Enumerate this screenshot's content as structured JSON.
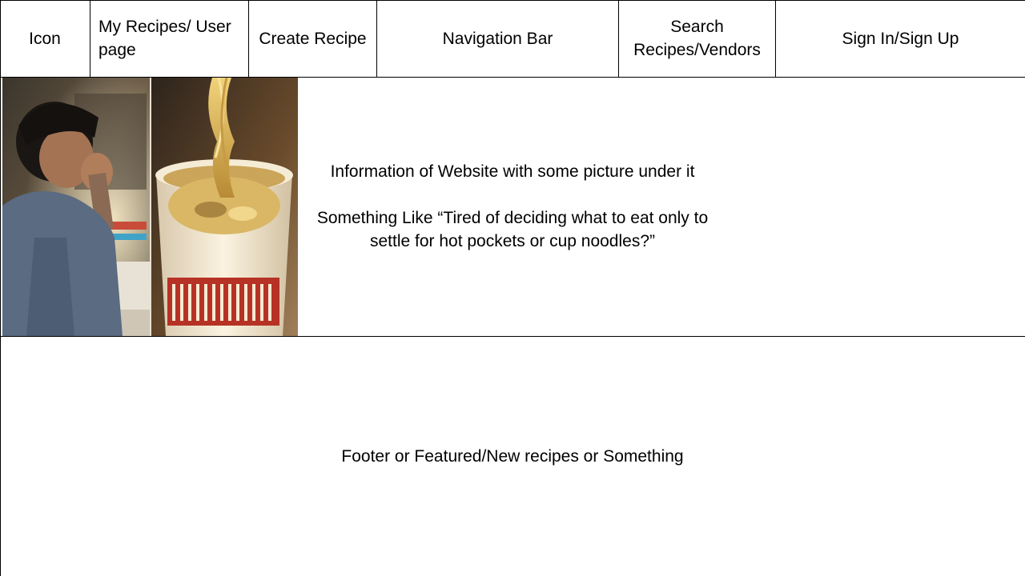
{
  "navbar": {
    "items": [
      {
        "label": "Icon"
      },
      {
        "label": "My Recipes/ User page"
      },
      {
        "label": "Create Recipe"
      },
      {
        "label": "Navigation Bar"
      },
      {
        "label": "Search Recipes/Vendors"
      },
      {
        "label": "Sign In/Sign Up"
      }
    ]
  },
  "hero": {
    "line1": "Information of Website with some picture under it",
    "line2": "Something Like “Tired of deciding what to eat only to settle for hot pockets or cup noodles?”",
    "image": {
      "icon": "student-and-cup-noodles-photo"
    }
  },
  "footer": {
    "text": "Footer or Featured/New recipes or Something"
  }
}
